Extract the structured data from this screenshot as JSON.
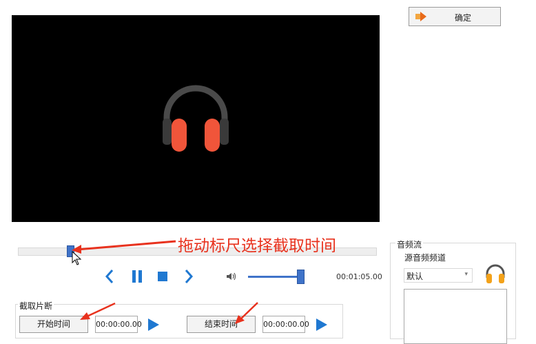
{
  "toolbar": {
    "ok_label": "确定"
  },
  "player": {
    "annotation": "拖动标尺选择截取时间",
    "total_time": "00:01:05.00",
    "seek_position": 0.14,
    "volume_level": 0.98
  },
  "clip": {
    "group_label": "截取片断",
    "start_label": "开始时间",
    "start_time": "00:00:00.00",
    "end_label": "结束时间",
    "end_time": "00:00:00.00"
  },
  "audio": {
    "group_label": "音频流",
    "source_label": "源音频频道",
    "selected_channel": "默认"
  },
  "colors": {
    "accent": "#1f78d1",
    "annotation": "#e8321e",
    "headphones_cup": "#f0553a"
  }
}
